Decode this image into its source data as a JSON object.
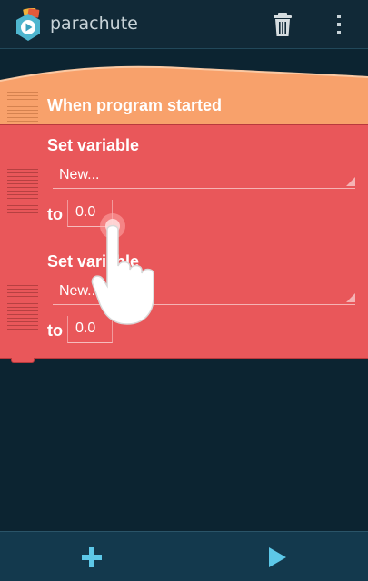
{
  "app": {
    "title": "parachute",
    "icon": "pocket-code-app-icon"
  },
  "action_bar": {
    "delete_icon": "trash-icon",
    "overflow_icon": "overflow-menu-icon"
  },
  "bricks": {
    "start": {
      "label": "When program started"
    },
    "set_variable_1": {
      "label": "Set variable",
      "variable_value": "New...",
      "to_label": "to",
      "value": "0.0"
    },
    "set_variable_2": {
      "label": "Set variable",
      "variable_value": "New...",
      "to_label": "to",
      "value": "0.0"
    }
  },
  "bottom_bar": {
    "add_icon": "plus-icon",
    "play_icon": "play-icon"
  },
  "colors": {
    "action_bar": "#112937",
    "background": "#0c2431",
    "start_brick": "#f8a16b",
    "set_variable_brick": "#e9575a",
    "bottom_bar": "#13394d",
    "icon": "#5dc8e8"
  }
}
